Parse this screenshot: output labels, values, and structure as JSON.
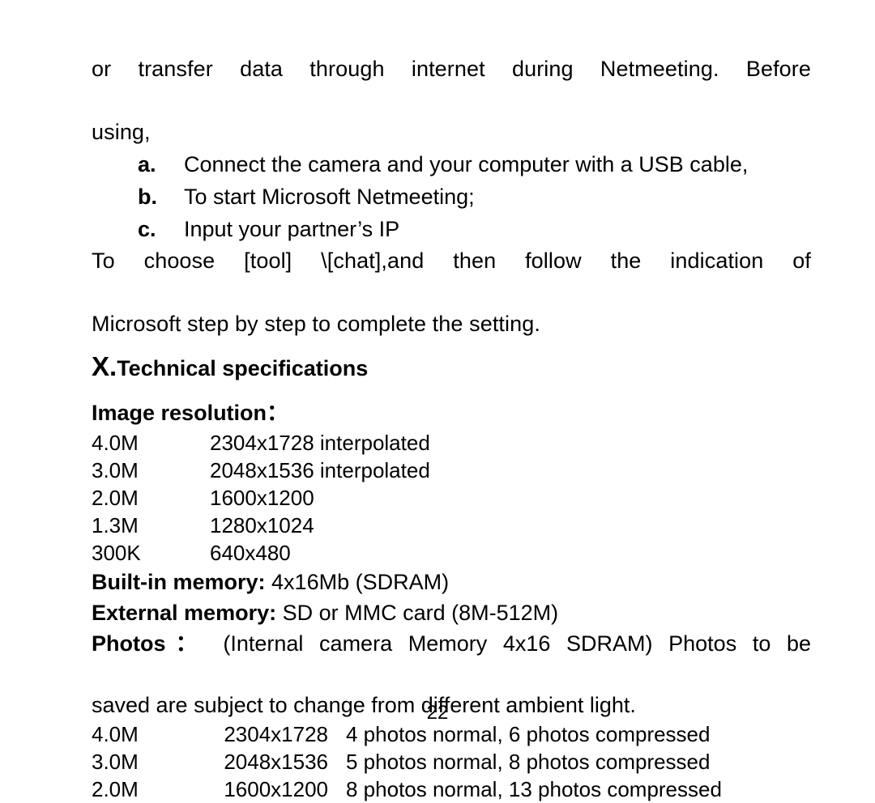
{
  "document": {
    "intro_paragraph": {
      "line1": "or  transfer  data  through  internet  during  Netmeeting.  Before",
      "line2": "using,"
    },
    "steps": [
      {
        "marker": "a.",
        "text": "Connect the camera and your computer with a USB cable,"
      },
      {
        "marker": "b.",
        "text": "To start Microsoft Netmeeting;"
      },
      {
        "marker": "c.",
        "text": "Input your partner’s IP"
      }
    ],
    "closing_paragraph": {
      "line1": "To   choose   [tool]   \\[chat],and   then   follow   the   indication   of",
      "line2": "Microsoft step by step to complete the setting."
    },
    "section": {
      "numeral": "X.",
      "title": "Technical specifications"
    },
    "image_resolution": {
      "heading": "Image resolution：",
      "rows": [
        {
          "size": "4.0M",
          "resolution": "2304x1728 interpolated"
        },
        {
          "size": "3.0M",
          "resolution": "2048x1536 interpolated"
        },
        {
          "size": "2.0M",
          "resolution": "1600x1200"
        },
        {
          "size": "1.3M",
          "resolution": "1280x1024"
        },
        {
          "size": "300K",
          "resolution": "640x480"
        }
      ]
    },
    "built_in_memory": {
      "label": "Built-in memory:",
      "value": "4x16Mb (SDRAM)"
    },
    "external_memory": {
      "label": "External memory:",
      "value": "SD or MMC card (8M-512M)"
    },
    "photos": {
      "label": "Photos：",
      "line1": "(Internal  camera  Memory  4x16  SDRAM)  Photos  to  be",
      "line2": "saved are subject to change from different ambient light.",
      "rows": [
        {
          "size": "4.0M",
          "resolution": "2304x1728",
          "capacity": "4 photos normal, 6 photos compressed"
        },
        {
          "size": "3.0M",
          "resolution": "2048x1536",
          "capacity": "5 photos normal, 8 photos compressed"
        },
        {
          "size": "2.0M",
          "resolution": "1600x1200",
          "capacity": "8 photos normal, 13 photos compressed"
        }
      ]
    },
    "page_number": "22"
  }
}
